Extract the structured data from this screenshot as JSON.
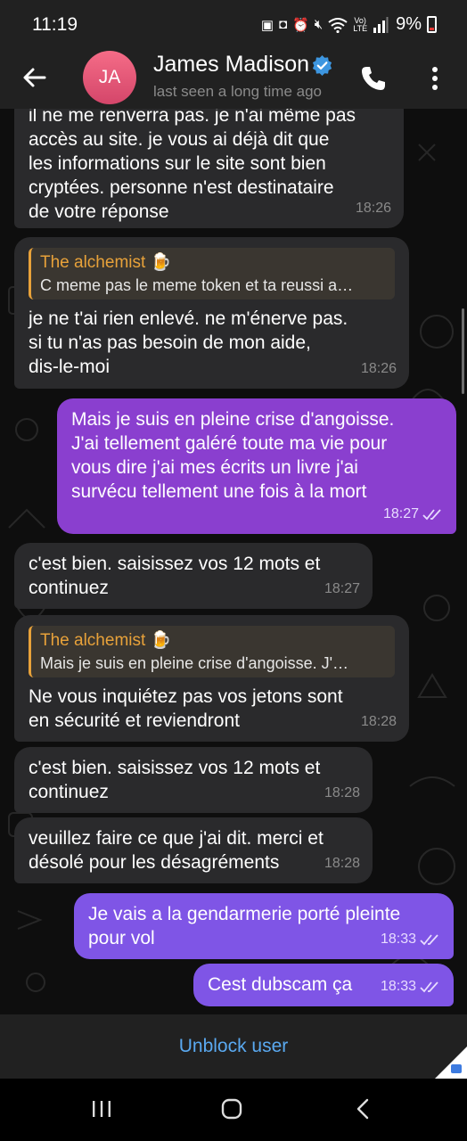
{
  "status_bar": {
    "time": "11:19",
    "battery": "9%",
    "icons": [
      "photo-icon",
      "nfc-icon",
      "alarm-icon",
      "mute-icon",
      "wifi-icon",
      "volte-icon",
      "signal-icon",
      "battery-icon"
    ]
  },
  "header": {
    "avatar_initials": "JA",
    "contact_name": "James Madison",
    "last_seen": "last seen a long time ago",
    "colors": {
      "avatar": "#e0577a",
      "verified": "#3d96e0"
    }
  },
  "messages": [
    {
      "direction": "in",
      "text": "il ne me renverra pas. je n'ai même pas\naccès au site. je vous ai déjà dit que\nles informations sur le site sont bien\ncryptées. personne n'est destinataire\nde votre réponse",
      "time": "18:26"
    },
    {
      "direction": "in",
      "reply_name": "The alchemist 🍺",
      "reply_text": "C meme pas le meme token et ta reussi a…",
      "text": "je ne t'ai rien enlevé. ne m'énerve pas.\nsi tu n'as pas besoin de mon aide,\ndis-le-moi",
      "time": "18:26"
    },
    {
      "direction": "out",
      "text": "Mais je suis en pleine crise d'angoisse.\nJ'ai tellement galéré toute ma vie pour\nvous dire j'ai mes écrits un livre j'ai\nsurvécu tellement une fois à la mort",
      "time": "18:27"
    },
    {
      "direction": "in",
      "text": "c'est bien. saisissez vos 12 mots et\ncontinuez",
      "time": "18:27"
    },
    {
      "direction": "in",
      "reply_name": "The alchemist 🍺",
      "reply_text": "Mais je suis en pleine crise d'angoisse.  J'…",
      "text": "Ne vous inquiétez pas vos jetons sont\nen sécurité et reviendront",
      "time": "18:28"
    },
    {
      "direction": "in",
      "text": "c'est bien. saisissez vos 12 mots et\ncontinuez",
      "time": "18:28"
    },
    {
      "direction": "in",
      "text": "veuillez faire ce que j'ai dit. merci et\ndésolé pour les désagréments",
      "time": "18:28"
    },
    {
      "direction": "out",
      "text": "Je vais a la gendarmerie porté pleinte\npour vol",
      "time": "18:33"
    },
    {
      "direction": "out",
      "text": "Cest dubscam ça",
      "time": "18:33"
    }
  ],
  "bottom": {
    "unblock_label": "Unblock user"
  },
  "colors": {
    "incoming_bubble": "#2a2a2c",
    "outgoing_bubble": "#8a3fcf",
    "reply_accent": "#e8a23a",
    "link": "#5aa9f0"
  }
}
